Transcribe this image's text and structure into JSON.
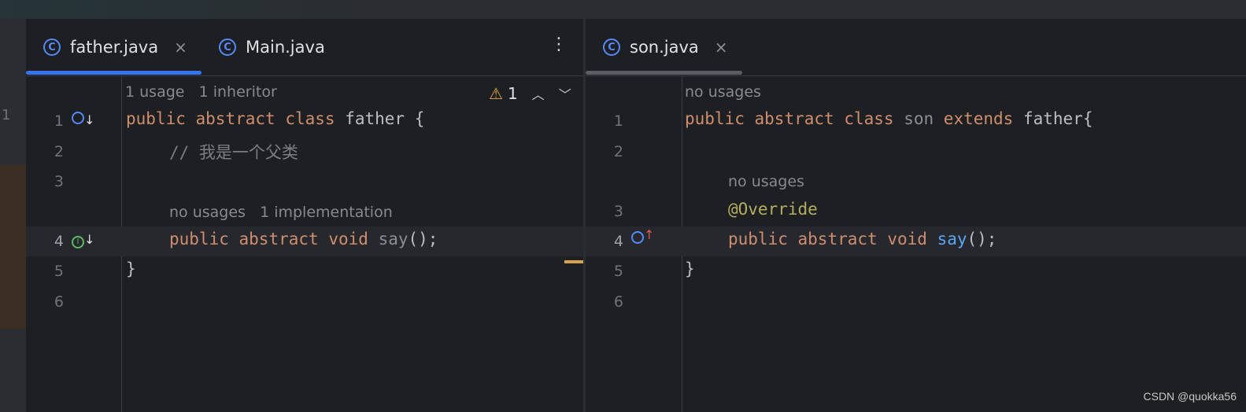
{
  "left_strip": {
    "line_number": "1"
  },
  "left_editor": {
    "tabs": [
      {
        "label": "father.java",
        "close": "×"
      },
      {
        "label": "Main.java"
      }
    ],
    "more_menu": "⋮",
    "inspection": {
      "count": "1"
    },
    "hints": {
      "class_usages": "1 usage",
      "class_inheritors": "1 inheritor",
      "method_usages": "no usages",
      "method_impl": "1 implementation"
    },
    "line_numbers": [
      "1",
      "2",
      "3",
      "4",
      "5",
      "6"
    ],
    "code": {
      "l1": {
        "kw1": "public",
        "kw2": "abstract",
        "kw3": "class",
        "name": "father",
        "brace": " {"
      },
      "l2": {
        "comment": "// 我是一个父类"
      },
      "l4": {
        "kw1": "public",
        "kw2": "abstract",
        "kw3": "void",
        "name": "say",
        "rest": "();"
      },
      "l5": {
        "brace": "}"
      }
    }
  },
  "right_editor": {
    "tabs": [
      {
        "label": "son.java",
        "close": "×"
      }
    ],
    "hints": {
      "class_usages": "no usages",
      "method_usages": "no usages"
    },
    "line_numbers": [
      "1",
      "2",
      "3",
      "4",
      "5",
      "6"
    ],
    "code": {
      "l1": {
        "kw1": "public",
        "kw2": "abstract",
        "kw3": "class",
        "name": "son",
        "kw4": "extends",
        "parent": "father{"
      },
      "l3": {
        "annotation": "@Override"
      },
      "l4": {
        "kw1": "public",
        "kw2": "abstract",
        "kw3": "void",
        "name": "say",
        "rest": "();"
      },
      "l5": {
        "brace": "}"
      }
    }
  },
  "watermark": "CSDN @quokka56",
  "colors": {
    "accent": "#548af7",
    "keyword": "#cf8e6d",
    "annotation": "#b3ae60",
    "function": "#56a8f5",
    "warning": "#e0a93c"
  }
}
